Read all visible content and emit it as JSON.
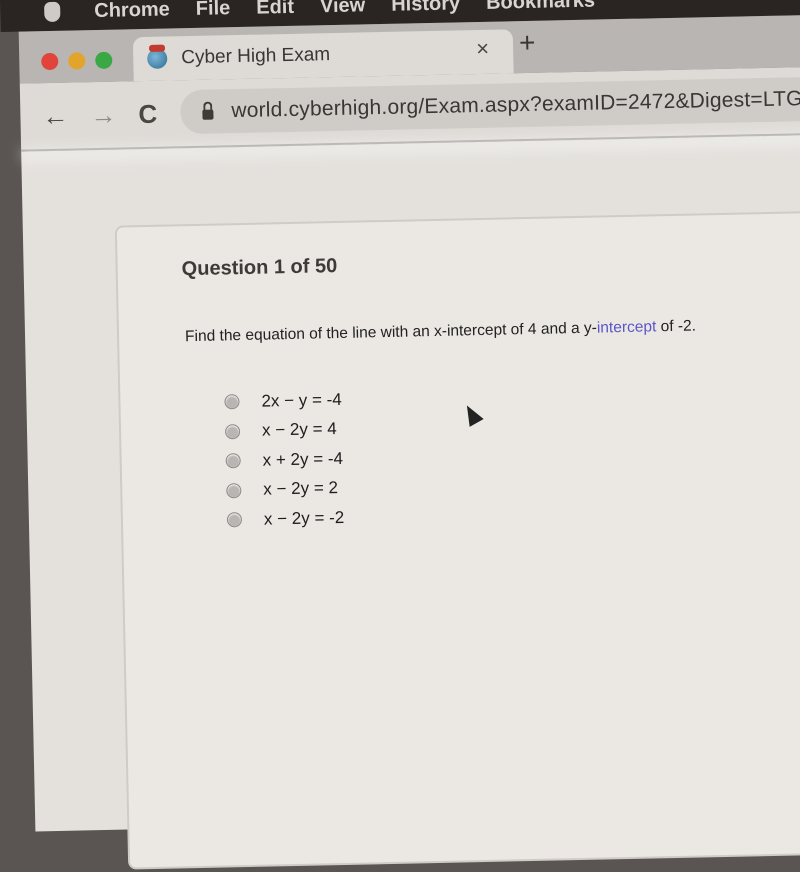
{
  "menubar": {
    "app_name": "Chrome",
    "items": [
      "File",
      "Edit",
      "View",
      "History",
      "Bookmarks"
    ]
  },
  "browser": {
    "traffic_lights": {
      "close": "#e0443b",
      "minimize": "#e3a42b",
      "maximize": "#3aa844"
    },
    "tab": {
      "title": "Cyber High Exam",
      "favicon": "globe-icon",
      "close_label": "×"
    },
    "new_tab_label": "+",
    "nav": {
      "back": "←",
      "forward": "→",
      "reload": "C"
    },
    "url": "world.cyberhigh.org/Exam.aspx?examID=2472&Digest=LTG"
  },
  "exam": {
    "question_header": "Question 1 of 50",
    "question_text_prefix": "Find the equation of the line with an x-intercept of 4 and a y-",
    "question_text_highlight": "intercept",
    "question_text_suffix": " of -2.",
    "options": [
      {
        "label": "2x − y = -4",
        "selected": false
      },
      {
        "label": "x − 2y = 4",
        "selected": false
      },
      {
        "label": "x + 2y = -4",
        "selected": false
      },
      {
        "label": "x − 2y = 2",
        "selected": false
      },
      {
        "label": "x − 2y = -2",
        "selected": false
      }
    ]
  }
}
